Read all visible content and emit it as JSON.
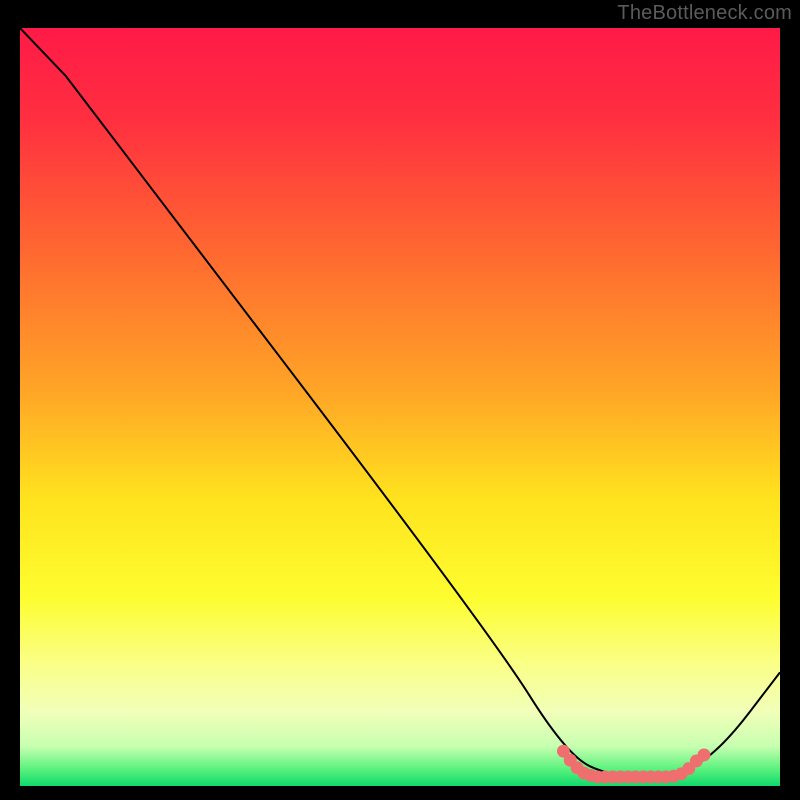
{
  "attribution": "TheBottleneck.com",
  "chart_data": {
    "type": "line",
    "title": "",
    "xlabel": "",
    "ylabel": "",
    "xlim": [
      0,
      100
    ],
    "ylim": [
      0,
      100
    ],
    "background_gradient": {
      "stops": [
        {
          "offset": 0.0,
          "color": "#ff1a47"
        },
        {
          "offset": 0.12,
          "color": "#ff2f40"
        },
        {
          "offset": 0.3,
          "color": "#ff6a30"
        },
        {
          "offset": 0.48,
          "color": "#ffa626"
        },
        {
          "offset": 0.62,
          "color": "#ffe31e"
        },
        {
          "offset": 0.75,
          "color": "#fdfd30"
        },
        {
          "offset": 0.84,
          "color": "#faff8a"
        },
        {
          "offset": 0.9,
          "color": "#f1ffb9"
        },
        {
          "offset": 0.945,
          "color": "#c7ffb0"
        },
        {
          "offset": 0.975,
          "color": "#5bf27e"
        },
        {
          "offset": 1.0,
          "color": "#06d66a"
        }
      ]
    },
    "series": [
      {
        "name": "bottleneck-curve",
        "color": "#000000",
        "points": [
          {
            "x": 0,
            "y": 100
          },
          {
            "x": 6,
            "y": 93.7
          },
          {
            "x": 62,
            "y": 20
          },
          {
            "x": 72,
            "y": 4
          },
          {
            "x": 78,
            "y": 1.2
          },
          {
            "x": 86,
            "y": 1.2
          },
          {
            "x": 92,
            "y": 4.5
          },
          {
            "x": 100,
            "y": 15
          }
        ]
      },
      {
        "name": "optimal-markers",
        "color": "#ef6f6f",
        "marker": "circle",
        "points": [
          {
            "x": 71.5,
            "y": 4.6
          },
          {
            "x": 72.4,
            "y": 3.4
          },
          {
            "x": 73.3,
            "y": 2.4
          },
          {
            "x": 74.2,
            "y": 1.7
          },
          {
            "x": 75.1,
            "y": 1.4
          },
          {
            "x": 76.0,
            "y": 1.2
          },
          {
            "x": 77.0,
            "y": 1.2
          },
          {
            "x": 78.0,
            "y": 1.2
          },
          {
            "x": 79.0,
            "y": 1.2
          },
          {
            "x": 80.0,
            "y": 1.2
          },
          {
            "x": 81.0,
            "y": 1.2
          },
          {
            "x": 82.0,
            "y": 1.2
          },
          {
            "x": 83.0,
            "y": 1.2
          },
          {
            "x": 84.0,
            "y": 1.2
          },
          {
            "x": 85.0,
            "y": 1.2
          },
          {
            "x": 86.0,
            "y": 1.3
          },
          {
            "x": 87.0,
            "y": 1.6
          },
          {
            "x": 88.0,
            "y": 2.3
          },
          {
            "x": 89.0,
            "y": 3.3
          },
          {
            "x": 90.0,
            "y": 4.1
          }
        ]
      }
    ]
  }
}
